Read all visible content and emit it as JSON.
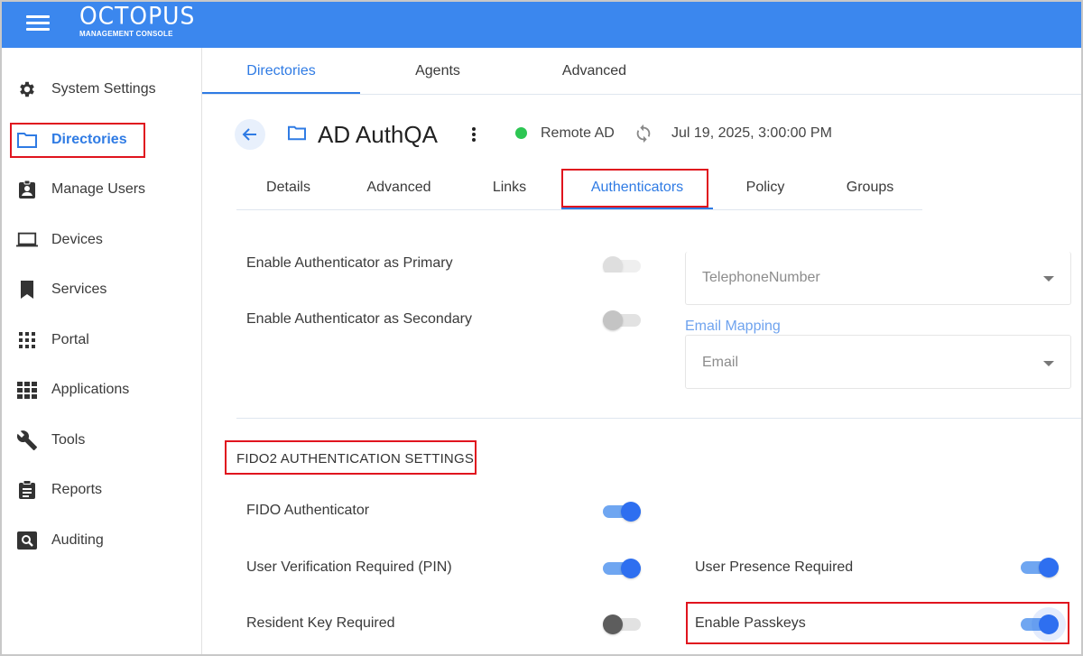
{
  "header": {
    "brand_name": "OCTOPUS",
    "brand_sub": "MANAGEMENT CONSOLE"
  },
  "sidebar": {
    "items": [
      {
        "label": "System Settings",
        "icon": "gear-icon"
      },
      {
        "label": "Directories",
        "icon": "folder-icon",
        "active": true
      },
      {
        "label": "Manage Users",
        "icon": "badge-icon"
      },
      {
        "label": "Devices",
        "icon": "laptop-icon"
      },
      {
        "label": "Services",
        "icon": "bookmark-icon"
      },
      {
        "label": "Portal",
        "icon": "grid-icon"
      },
      {
        "label": "Applications",
        "icon": "apps-icon"
      },
      {
        "label": "Tools",
        "icon": "wrench-icon"
      },
      {
        "label": "Reports",
        "icon": "clipboard-icon"
      },
      {
        "label": "Auditing",
        "icon": "search-icon"
      }
    ]
  },
  "top_tabs": [
    "Directories",
    "Agents",
    "Advanced"
  ],
  "entity": {
    "title": "AD AuthQA",
    "status": "Remote AD",
    "timestamp": "Jul 19, 2025, 3:00:00 PM"
  },
  "sub_tabs": [
    "Details",
    "Advanced",
    "Links",
    "Authenticators",
    "Policy",
    "Groups"
  ],
  "settings": {
    "primary_label": "Enable Authenticator as Primary",
    "primary_on": false,
    "secondary_label": "Enable Authenticator as Secondary",
    "secondary_on": false,
    "phone_mapping_value": "TelephoneNumber",
    "email_mapping_label": "Email Mapping",
    "email_mapping_value": "Email"
  },
  "fido2": {
    "section_title": "FIDO2 AUTHENTICATION SETTINGS",
    "fido_authenticator_label": "FIDO Authenticator",
    "fido_authenticator_on": true,
    "user_verification_label": "User Verification Required (PIN)",
    "user_verification_on": true,
    "user_presence_label": "User Presence Required",
    "user_presence_on": true,
    "resident_key_label": "Resident Key Required",
    "resident_key_on": false,
    "passkeys_label": "Enable Passkeys",
    "passkeys_on": true
  },
  "colors": {
    "header": "#3b87ee",
    "accent": "#2f7be4",
    "highlight_box": "#e0141e",
    "status_ok": "#2dc653"
  }
}
